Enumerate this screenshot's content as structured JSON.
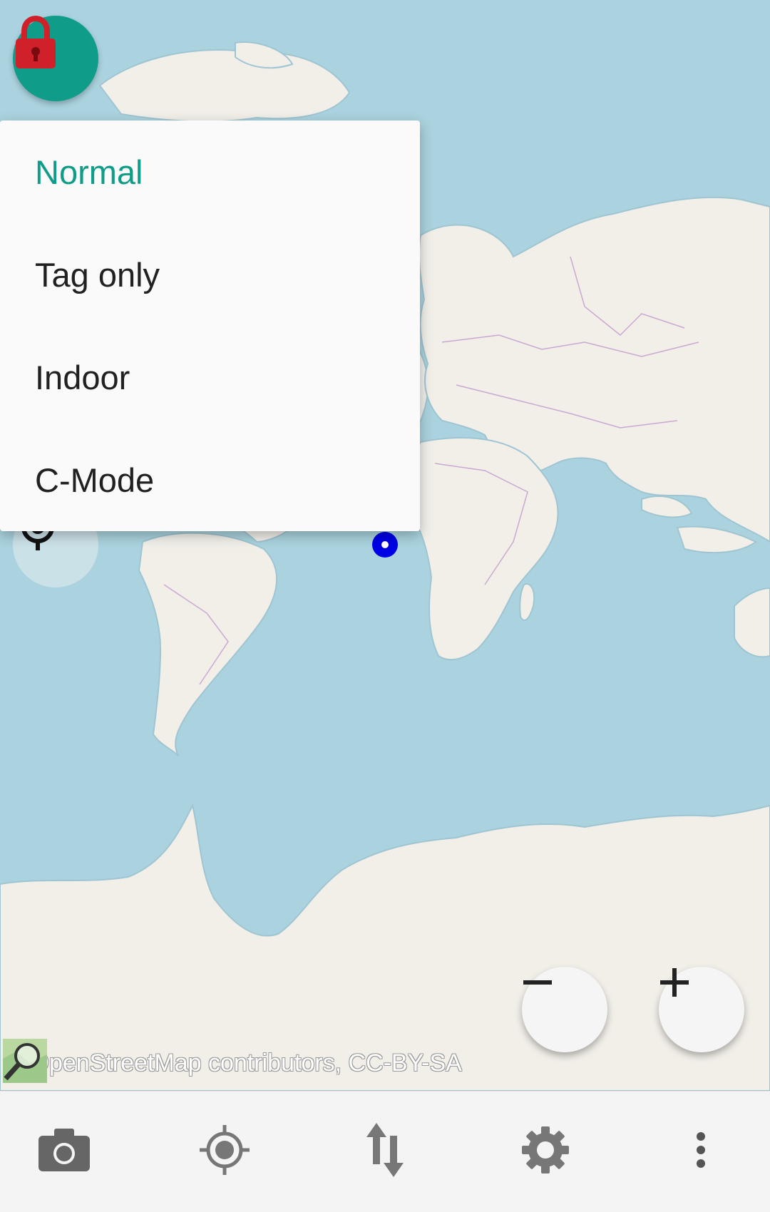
{
  "map": {
    "attribution": "© OpenStreetMap contributors, CC-BY-SA",
    "icons": {
      "lock": "lock-icon",
      "gps": "gps-crosshair-icon",
      "location_marker": "location-marker-icon",
      "attribution_logo": "magnifier-map-icon"
    },
    "colors": {
      "water": "#aad3df",
      "land": "#f2efe9",
      "borders": "#c9a8d1",
      "accent": "#0f9d8a",
      "lock_red": "#d0202a",
      "marker": "#0000e6"
    }
  },
  "mode_menu": {
    "items": [
      {
        "label": "Normal",
        "selected": true
      },
      {
        "label": "Tag only",
        "selected": false
      },
      {
        "label": "Indoor",
        "selected": false
      },
      {
        "label": "C-Mode",
        "selected": false
      }
    ]
  },
  "zoom": {
    "out_icon": "minus-icon",
    "in_icon": "plus-icon"
  },
  "bottom_bar": {
    "items": [
      {
        "name": "camera-button",
        "icon": "camera-icon"
      },
      {
        "name": "gps-button",
        "icon": "gps-icon"
      },
      {
        "name": "transfer-button",
        "icon": "transfer-arrows-icon"
      },
      {
        "name": "preferences-button",
        "icon": "gear-icon"
      },
      {
        "name": "overflow-menu-button",
        "icon": "more-vertical-icon"
      }
    ]
  }
}
